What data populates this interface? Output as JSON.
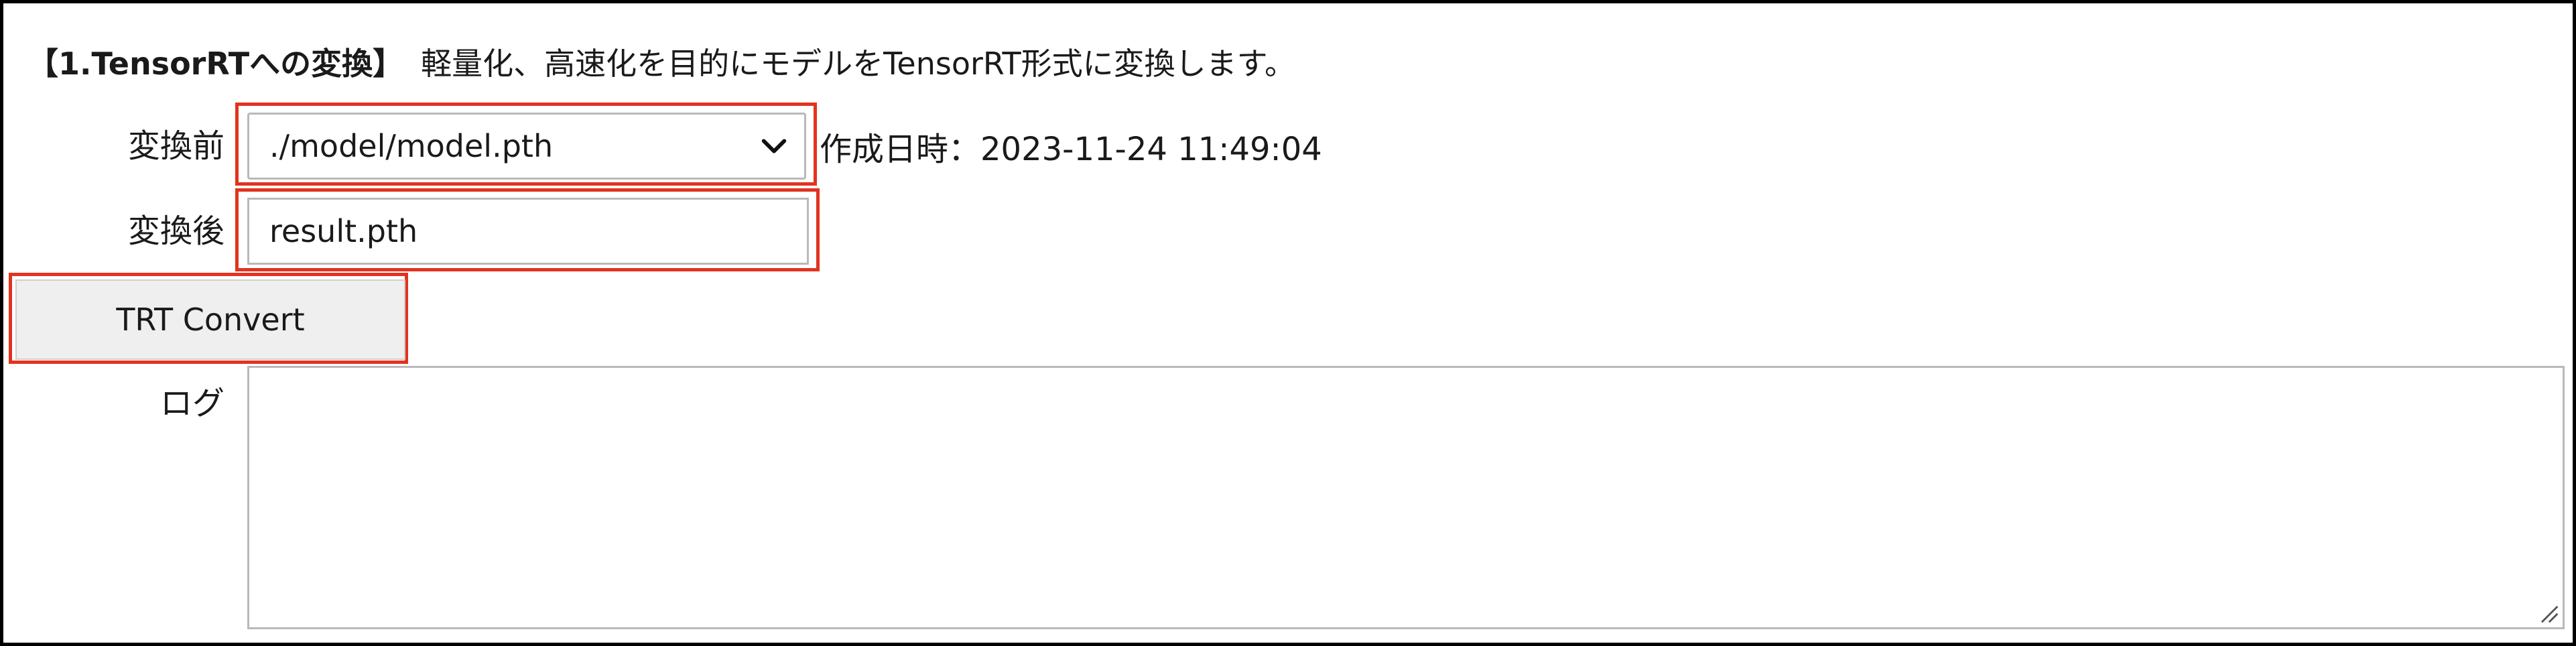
{
  "section": {
    "title": "【1.TensorRTへの変換】",
    "description": "軽量化、高速化を目的にモデルをTensorRT形式に変換します。"
  },
  "form": {
    "before_label": "変換前",
    "before_value": "./model/model.pth",
    "created_text": "作成日時：2023-11-24 11:49:04",
    "after_label": "変換後",
    "after_value": "result.pth",
    "convert_button": "TRT Convert",
    "log_label": "ログ",
    "log_value": ""
  },
  "icons": {
    "select_arrow": "chevron-down-icon",
    "resize": "resize-grip-icon"
  },
  "colors": {
    "highlight": "#e2331f",
    "button_bg": "#efefef",
    "field_border": "#b9b9b9"
  }
}
